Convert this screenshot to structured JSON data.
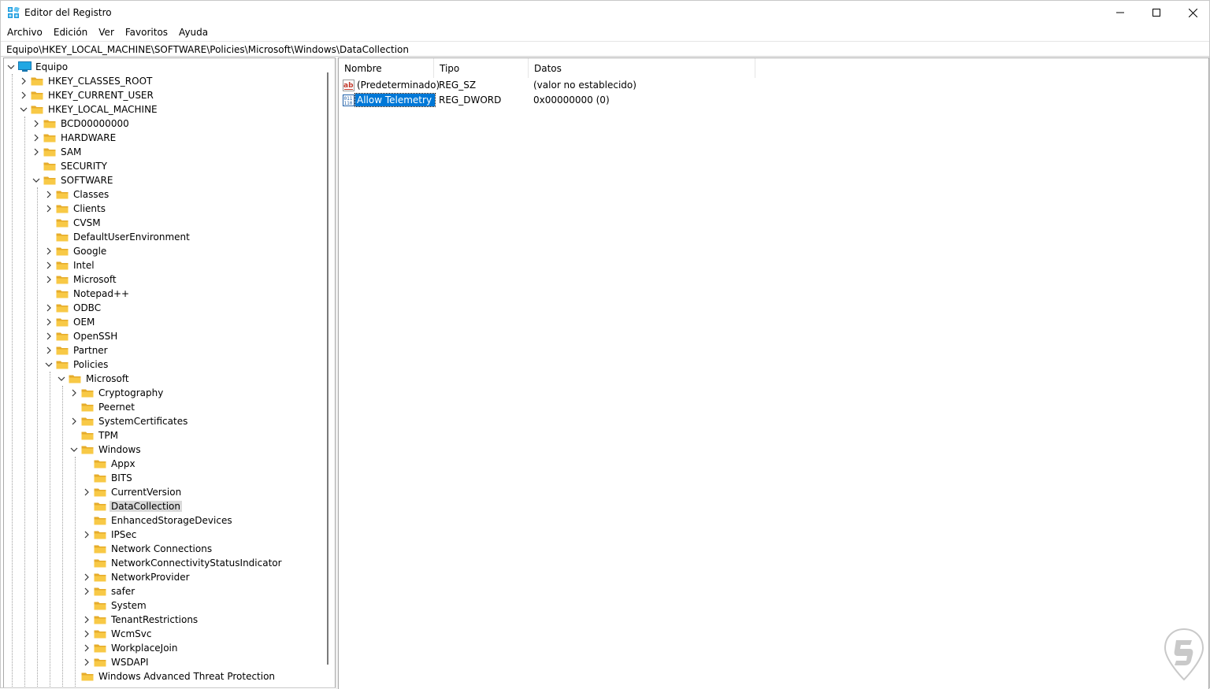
{
  "window": {
    "title": "Editor del Registro"
  },
  "menu": {
    "items": [
      "Archivo",
      "Edición",
      "Ver",
      "Favoritos",
      "Ayuda"
    ]
  },
  "address": {
    "path": "Equipo\\HKEY_LOCAL_MACHINE\\SOFTWARE\\Policies\\Microsoft\\Windows\\DataCollection"
  },
  "tree": {
    "root": "Equipo",
    "nodes": [
      {
        "label": "HKEY_CLASSES_ROOT",
        "depth": 1,
        "expander": "collapsed"
      },
      {
        "label": "HKEY_CURRENT_USER",
        "depth": 1,
        "expander": "collapsed"
      },
      {
        "label": "HKEY_LOCAL_MACHINE",
        "depth": 1,
        "expander": "expanded"
      },
      {
        "label": "BCD00000000",
        "depth": 2,
        "expander": "collapsed"
      },
      {
        "label": "HARDWARE",
        "depth": 2,
        "expander": "collapsed"
      },
      {
        "label": "SAM",
        "depth": 2,
        "expander": "collapsed"
      },
      {
        "label": "SECURITY",
        "depth": 2,
        "expander": "none"
      },
      {
        "label": "SOFTWARE",
        "depth": 2,
        "expander": "expanded"
      },
      {
        "label": "Classes",
        "depth": 3,
        "expander": "collapsed"
      },
      {
        "label": "Clients",
        "depth": 3,
        "expander": "collapsed"
      },
      {
        "label": "CVSM",
        "depth": 3,
        "expander": "none"
      },
      {
        "label": "DefaultUserEnvironment",
        "depth": 3,
        "expander": "none"
      },
      {
        "label": "Google",
        "depth": 3,
        "expander": "collapsed"
      },
      {
        "label": "Intel",
        "depth": 3,
        "expander": "collapsed"
      },
      {
        "label": "Microsoft",
        "depth": 3,
        "expander": "collapsed"
      },
      {
        "label": "Notepad++",
        "depth": 3,
        "expander": "none"
      },
      {
        "label": "ODBC",
        "depth": 3,
        "expander": "collapsed"
      },
      {
        "label": "OEM",
        "depth": 3,
        "expander": "collapsed"
      },
      {
        "label": "OpenSSH",
        "depth": 3,
        "expander": "collapsed"
      },
      {
        "label": "Partner",
        "depth": 3,
        "expander": "collapsed"
      },
      {
        "label": "Policies",
        "depth": 3,
        "expander": "expanded"
      },
      {
        "label": "Microsoft",
        "depth": 4,
        "expander": "expanded"
      },
      {
        "label": "Cryptography",
        "depth": 5,
        "expander": "collapsed"
      },
      {
        "label": "Peernet",
        "depth": 5,
        "expander": "none"
      },
      {
        "label": "SystemCertificates",
        "depth": 5,
        "expander": "collapsed"
      },
      {
        "label": "TPM",
        "depth": 5,
        "expander": "none"
      },
      {
        "label": "Windows",
        "depth": 5,
        "expander": "expanded"
      },
      {
        "label": "Appx",
        "depth": 6,
        "expander": "none"
      },
      {
        "label": "BITS",
        "depth": 6,
        "expander": "none"
      },
      {
        "label": "CurrentVersion",
        "depth": 6,
        "expander": "collapsed"
      },
      {
        "label": "DataCollection",
        "depth": 6,
        "expander": "none",
        "selected": true
      },
      {
        "label": "EnhancedStorageDevices",
        "depth": 6,
        "expander": "none"
      },
      {
        "label": "IPSec",
        "depth": 6,
        "expander": "collapsed"
      },
      {
        "label": "Network Connections",
        "depth": 6,
        "expander": "none"
      },
      {
        "label": "NetworkConnectivityStatusIndicator",
        "depth": 6,
        "expander": "none"
      },
      {
        "label": "NetworkProvider",
        "depth": 6,
        "expander": "collapsed"
      },
      {
        "label": "safer",
        "depth": 6,
        "expander": "collapsed"
      },
      {
        "label": "System",
        "depth": 6,
        "expander": "none"
      },
      {
        "label": "TenantRestrictions",
        "depth": 6,
        "expander": "collapsed"
      },
      {
        "label": "WcmSvc",
        "depth": 6,
        "expander": "collapsed"
      },
      {
        "label": "WorkplaceJoin",
        "depth": 6,
        "expander": "collapsed"
      },
      {
        "label": "WSDAPI",
        "depth": 6,
        "expander": "collapsed"
      },
      {
        "label": "Windows Advanced Threat Protection",
        "depth": 5,
        "expander": "none"
      }
    ]
  },
  "list": {
    "columns": [
      "Nombre",
      "Tipo",
      "Datos"
    ],
    "rows": [
      {
        "name": "(Predeterminado)",
        "type": "REG_SZ",
        "data": "(valor no establecido)",
        "icon": "string-value-icon",
        "selected": false
      },
      {
        "name": "Allow Telemetry",
        "type": "REG_DWORD",
        "data": "0x00000000 (0)",
        "icon": "binary-value-icon",
        "selected": true
      }
    ]
  },
  "colors": {
    "selection": "#0078d7",
    "folder": "#f8c946",
    "tree_selection": "#d9d9d9"
  }
}
